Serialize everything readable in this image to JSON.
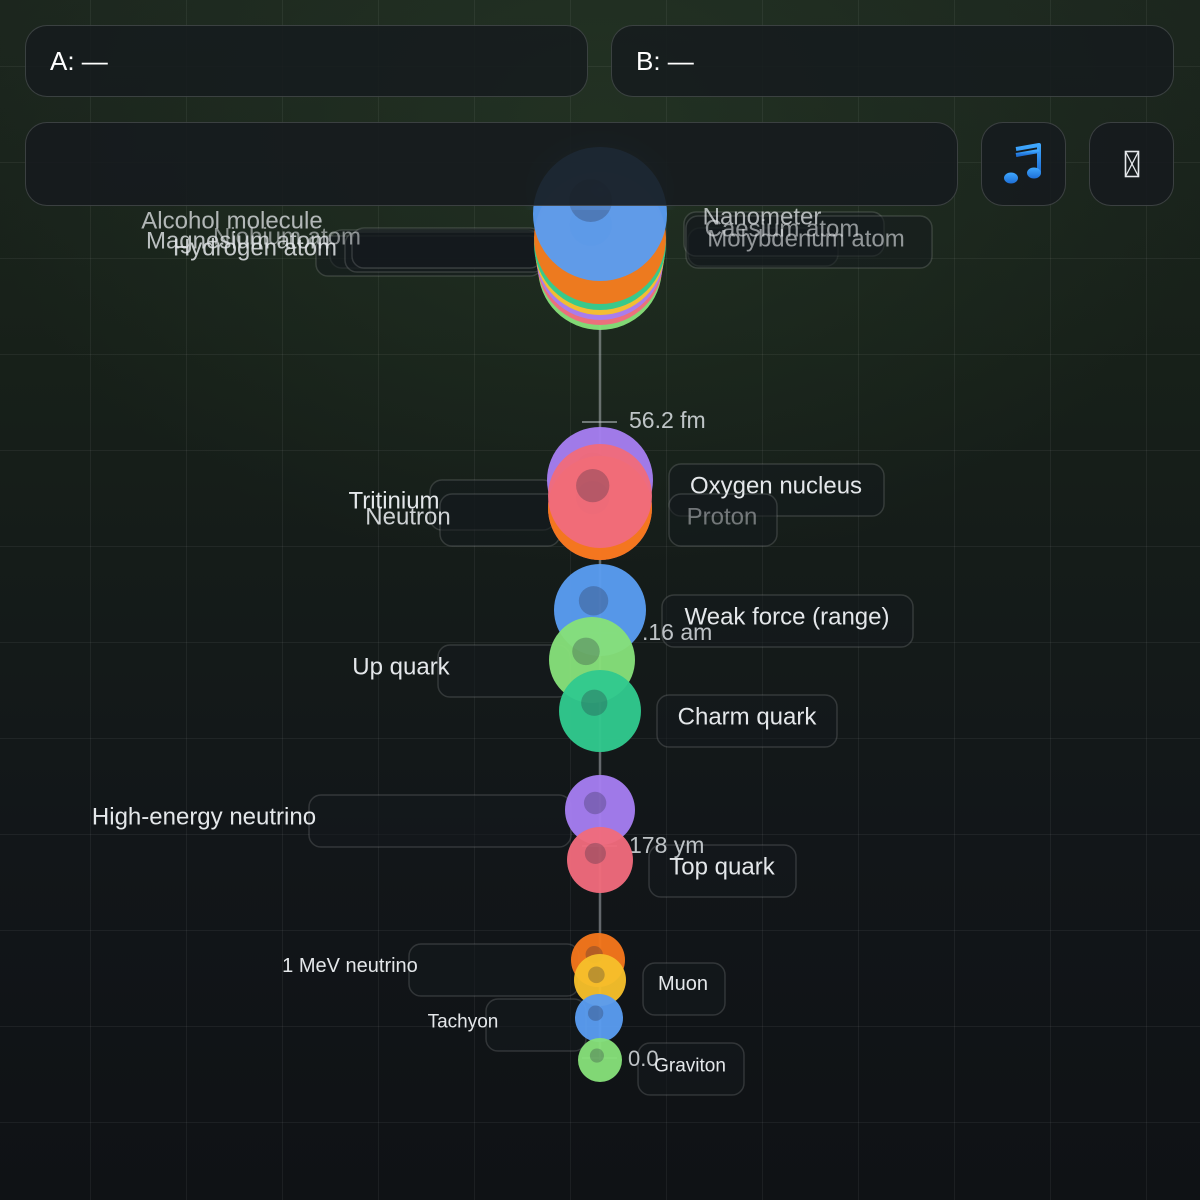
{
  "inputs": {
    "a_label": "A: —",
    "b_label": "B: —",
    "search_value": "",
    "search_placeholder": ""
  },
  "buttons": {
    "music_icon": "musical-note-icon",
    "extra_icon": "missing-glyph-icon",
    "extra_glyph": "▯"
  },
  "colors": {
    "blue": "#5a9cf0",
    "purple": "#a57ef0",
    "green": "#86e07a",
    "teal": "#31c98e",
    "pink": "#f06b7c",
    "orange": "#f5771b",
    "yellow": "#f6c02b"
  },
  "scale": {
    "ruler_labels": [
      "56.2 fm",
      ".16 am",
      "178 ym",
      "0.0"
    ],
    "items": [
      {
        "name": "Alcohol molecule",
        "side": "left",
        "color": "#86e07a"
      },
      {
        "name": "Magnesium atom",
        "side": "left",
        "color": "#f06b7c"
      },
      {
        "name": "Niobium atom",
        "side": "left",
        "color": "#a57ef0"
      },
      {
        "name": "Hydrogen atom",
        "side": "left",
        "color": "#f6c02b"
      },
      {
        "name": "Nanometer",
        "side": "right",
        "color": "#31c98e"
      },
      {
        "name": "Caesium atom",
        "side": "right",
        "color": "#f5771b"
      },
      {
        "name": "Molybdenum atom",
        "side": "right",
        "color": "#5a9cf0"
      },
      {
        "name": "Oxygen nucleus",
        "side": "right",
        "color": "#a57ef0"
      },
      {
        "name": "Proton",
        "side": "right",
        "color": "#f06b7c"
      },
      {
        "name": "Tritinium",
        "side": "left",
        "color": "#f5771b"
      },
      {
        "name": "Neutron",
        "side": "left",
        "color": "#f06b7c"
      },
      {
        "name": "Weak force (range)",
        "side": "right",
        "color": "#5a9cf0"
      },
      {
        "name": "Up quark",
        "side": "left",
        "color": "#86e07a"
      },
      {
        "name": "Charm quark",
        "side": "right",
        "color": "#31c98e"
      },
      {
        "name": "High-energy neutrino",
        "side": "left",
        "color": "#a57ef0"
      },
      {
        "name": "Top quark",
        "side": "right",
        "color": "#f06b7c"
      },
      {
        "name": "1 MeV neutrino",
        "side": "left",
        "color": "#f5771b"
      },
      {
        "name": "Muon",
        "side": "right",
        "color": "#f6c02b"
      },
      {
        "name": "Tachyon",
        "side": "left",
        "color": "#5a9cf0"
      },
      {
        "name": "Graviton",
        "side": "right",
        "color": "#86e07a"
      }
    ]
  }
}
